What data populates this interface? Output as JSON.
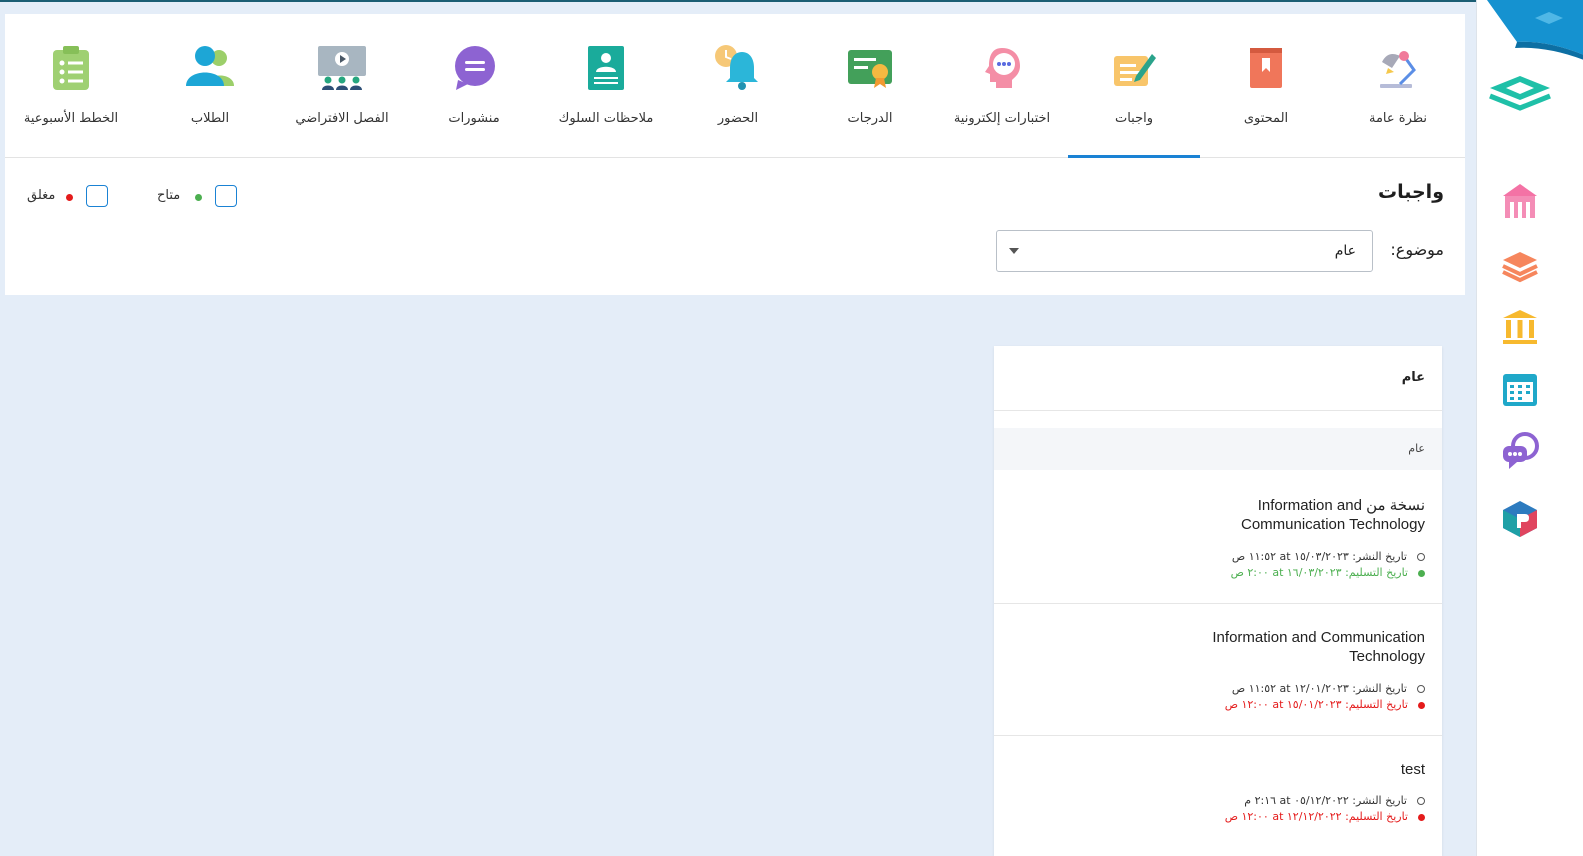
{
  "nav": {
    "items": [
      {
        "label": "نظرة عامة",
        "icon": "overview-lamp-icon"
      },
      {
        "label": "المحتوى",
        "icon": "content-book-icon"
      },
      {
        "label": "واجبات",
        "icon": "homework-pen-icon",
        "active": true
      },
      {
        "label": "اختبارات إلكترونية",
        "icon": "e-quiz-head-icon"
      },
      {
        "label": "الدرجات",
        "icon": "grades-certificate-icon"
      },
      {
        "label": "الحضور",
        "icon": "attendance-bell-icon"
      },
      {
        "label": "ملاحظات السلوك",
        "icon": "behavior-notes-icon"
      },
      {
        "label": "منشورات",
        "icon": "posts-chat-icon"
      },
      {
        "label": "الفصل الافتراضي",
        "icon": "virtual-class-icon"
      },
      {
        "label": "الطلاب",
        "icon": "students-icon"
      },
      {
        "label": "الخطط الأسبوعية",
        "icon": "weekly-plans-clipboard-icon"
      }
    ]
  },
  "page": {
    "title": "واجبات"
  },
  "filters": {
    "available": {
      "label": "متاح",
      "color": "#4caf50"
    },
    "closed": {
      "label": "مغلق",
      "color": "#e41b1b"
    }
  },
  "subject": {
    "label": "موضوع:",
    "value": "عام"
  },
  "card": {
    "header": "عام",
    "group": "عام",
    "items": [
      {
        "title": "نسخة من Information and Communication Technology",
        "published": "تاريخ النشر: ١٥/٠٣/٢٠٢٣ at ١١:٥٢ ص",
        "due": "تاريخ التسليم: ١٦/٠٣/٢٠٢٣ at ٢:٠٠ ص",
        "status": "available"
      },
      {
        "title": "Information and Communication Technology",
        "published": "تاريخ النشر: ١٢/٠١/٢٠٢٣ at ١١:٥٢ ص",
        "due": "تاريخ التسليم: ١٥/٠١/٢٠٢٣ at ١٢:٠٠ ص",
        "status": "closed"
      },
      {
        "title": "test",
        "published": "تاريخ النشر: ٠٥/١٢/٢٠٢٢ at ٢:١٦ م",
        "due": "تاريخ التسليم: ١٢/١٢/٢٠٢٢ at ١٢:٠٠ ص",
        "status": "closed"
      }
    ]
  },
  "sidebar": {
    "icons": [
      "school-icon",
      "layers-icon",
      "institution-icon",
      "calendar-icon",
      "chat-support-icon",
      "package-icon"
    ]
  },
  "colors": {
    "accent": "#1a82d4",
    "available": "#4caf50",
    "closed": "#e41b1b"
  }
}
